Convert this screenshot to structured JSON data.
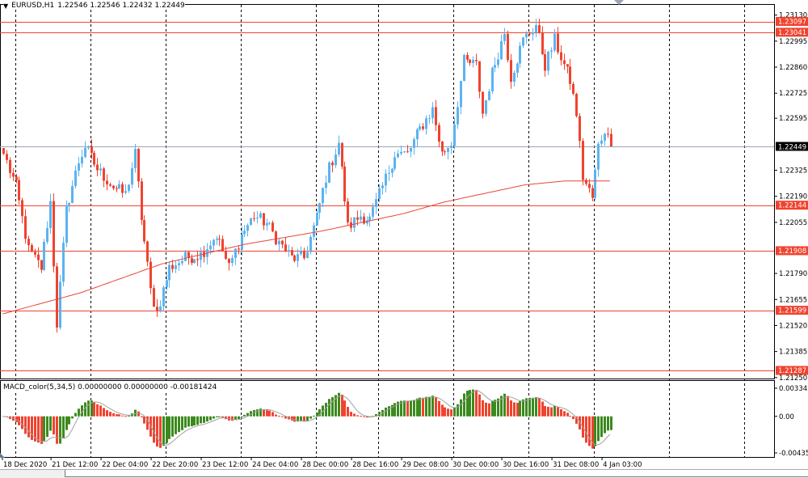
{
  "header": {
    "symbol": "EURUSD,H1",
    "ohlc": "1.22546 1.22546 1.22432 1.22449"
  },
  "macd_header": {
    "label": "MACD_color(5,34,5) 0.00000000 0.00000000 -0.00181424"
  },
  "colors": {
    "bull": "#5cb3ef",
    "bear": "#f0432f",
    "level": "#f0432f",
    "ma": "#e8453a",
    "grid": "#000000",
    "current": "#9aa6b4",
    "macd_up": "#3c8a1e",
    "macd_down": "#f0432f",
    "signal": "#a0a0a0"
  },
  "chart_data": {
    "type": "candlestick",
    "symbol": "EURUSD",
    "timeframe": "H1",
    "ylim": [
      1.2125,
      1.2313
    ],
    "price_ticks": [
      "1.23130",
      "1.22995",
      "1.22860",
      "1.22725",
      "1.22595",
      "1.22325",
      "1.22190",
      "1.22055",
      "1.21790",
      "1.21655",
      "1.21520",
      "1.21385",
      "1.21250"
    ],
    "current_price": "1.22449",
    "levels": [
      "1.23097",
      "1.23041",
      "1.22144",
      "1.21908",
      "1.21599",
      "1.21287"
    ],
    "bars": 195,
    "close_keyframes": [
      [
        0,
        1.2241
      ],
      [
        4,
        1.2224
      ],
      [
        8,
        1.2191
      ],
      [
        12,
        1.2182
      ],
      [
        15,
        1.2216
      ],
      [
        17,
        1.2153
      ],
      [
        20,
        1.2212
      ],
      [
        24,
        1.2237
      ],
      [
        26,
        1.2245
      ],
      [
        30,
        1.2233
      ],
      [
        35,
        1.2224
      ],
      [
        39,
        1.222
      ],
      [
        42,
        1.2241
      ],
      [
        44,
        1.2208
      ],
      [
        47,
        1.217
      ],
      [
        49,
        1.2159
      ],
      [
        53,
        1.2182
      ],
      [
        58,
        1.2187
      ],
      [
        63,
        1.2189
      ],
      [
        68,
        1.2199
      ],
      [
        72,
        1.2182
      ],
      [
        76,
        1.2199
      ],
      [
        80,
        1.2209
      ],
      [
        84,
        1.2205
      ],
      [
        88,
        1.2195
      ],
      [
        92,
        1.2187
      ],
      [
        96,
        1.2187
      ],
      [
        100,
        1.2208
      ],
      [
        103,
        1.2229
      ],
      [
        107,
        1.2247
      ],
      [
        110,
        1.2203
      ],
      [
        114,
        1.2209
      ],
      [
        117,
        1.2207
      ],
      [
        121,
        1.2224
      ],
      [
        125,
        1.2241
      ],
      [
        129,
        1.2241
      ],
      [
        133,
        1.2254
      ],
      [
        137,
        1.2264
      ],
      [
        140,
        1.2241
      ],
      [
        143,
        1.2247
      ],
      [
        147,
        1.2289
      ],
      [
        151,
        1.2287
      ],
      [
        153,
        1.2262
      ],
      [
        156,
        1.2283
      ],
      [
        160,
        1.2304
      ],
      [
        162,
        1.2281
      ],
      [
        166,
        1.23
      ],
      [
        170,
        1.2308
      ],
      [
        173,
        1.2287
      ],
      [
        176,
        1.23
      ],
      [
        179,
        1.2287
      ],
      [
        181,
        1.2279
      ],
      [
        183,
        1.2262
      ],
      [
        185,
        1.2229
      ],
      [
        188,
        1.2218
      ],
      [
        190,
        1.2245
      ],
      [
        192,
        1.2254
      ],
      [
        194,
        1.22449
      ]
    ],
    "ma_keyframes": [
      [
        0,
        1.2158
      ],
      [
        25,
        1.2169
      ],
      [
        51,
        1.2184
      ],
      [
        77,
        1.2194
      ],
      [
        102,
        1.2201
      ],
      [
        128,
        1.221
      ],
      [
        141,
        1.2216
      ],
      [
        167,
        1.2225
      ],
      [
        180,
        1.2227
      ],
      [
        194,
        1.2227
      ]
    ],
    "macd": {
      "params": "5,34,5",
      "ylim": [
        -0.00435,
        0.003343
      ],
      "ticks": [
        "0.003343",
        "0.00",
        "-0.00435"
      ]
    },
    "time_labels": [
      {
        "bar": 0,
        "label": "18 Dec 2020"
      },
      {
        "bar": 15.5,
        "label": "21 Dec 12:00"
      },
      {
        "bar": 31.5,
        "label": "22 Dec 04:00"
      },
      {
        "bar": 47.5,
        "label": "22 Dec 20:00"
      },
      {
        "bar": 63.5,
        "label": "23 Dec 12:00"
      },
      {
        "bar": 79.5,
        "label": "24 Dec 04:00"
      },
      {
        "bar": 95.5,
        "label": "28 Dec 00:00"
      },
      {
        "bar": 111.5,
        "label": "28 Dec 16:00"
      },
      {
        "bar": 127.5,
        "label": "29 Dec 08:00"
      },
      {
        "bar": 143.5,
        "label": "30 Dec 00:00"
      },
      {
        "bar": 159.5,
        "label": "30 Dec 16:00"
      },
      {
        "bar": 175.5,
        "label": "31 Dec 08:00"
      },
      {
        "bar": 191.5,
        "label": "4 Jan 03:00"
      }
    ],
    "grid_bars": [
      4,
      28,
      52,
      76,
      100,
      120,
      144,
      168,
      189,
      213,
      237
    ]
  }
}
